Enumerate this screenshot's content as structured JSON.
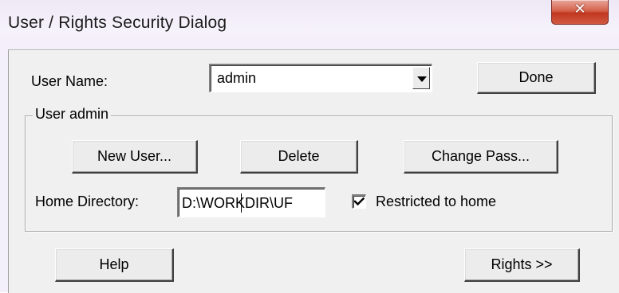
{
  "window": {
    "title": "User / Rights Security Dialog",
    "close_glyph": "✕"
  },
  "user": {
    "name_label": "User Name:",
    "selected_user": "admin",
    "done_label": "Done"
  },
  "group": {
    "legend": "User admin",
    "new_user_label": "New User...",
    "delete_label": "Delete",
    "change_pass_label": "Change Pass...",
    "home_dir_label": "Home Directory:",
    "home_dir_value": "D:\\WORKDIR\\UF",
    "restricted_label": "Restricted to home",
    "restricted_checked": true
  },
  "footer": {
    "help_label": "Help",
    "rights_label": "Rights >>"
  },
  "icons": {
    "close": "close-icon",
    "dropdown": "chevron-down-icon",
    "check": "checkmark-icon"
  },
  "colors": {
    "close_button": "#c9452c",
    "dialog_face": "#f0f0f0",
    "title_bar": "#f3eefa"
  }
}
